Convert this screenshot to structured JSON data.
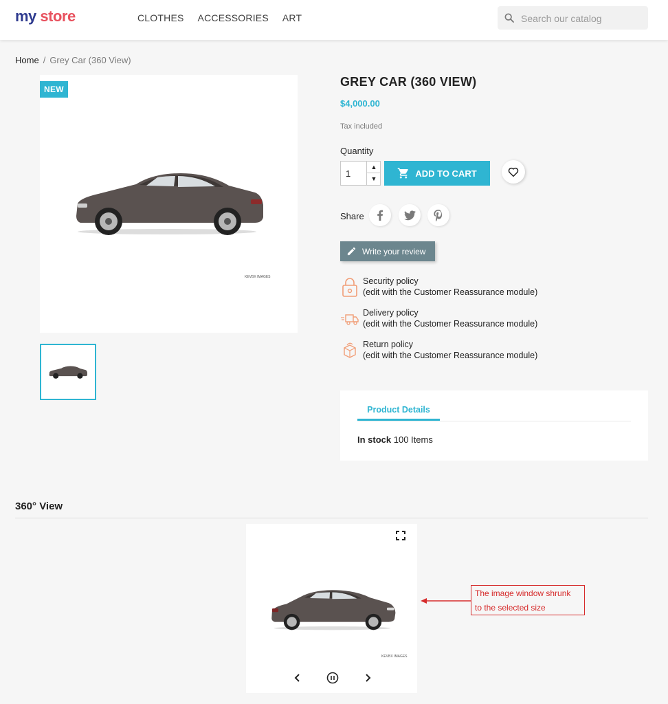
{
  "header": {
    "logo_part1": "my",
    "logo_part2": "store",
    "nav": [
      "CLOTHES",
      "ACCESSORIES",
      "ART"
    ],
    "search_placeholder": "Search our catalog"
  },
  "breadcrumb": {
    "home": "Home",
    "separator": "/",
    "current": "Grey Car (360 View)"
  },
  "product": {
    "badge": "NEW",
    "watermark": "KEVBX IMAGES",
    "title": "GREY CAR (360 VIEW)",
    "price": "$4,000.00",
    "tax_note": "Tax included",
    "quantity_label": "Quantity",
    "quantity_value": "1",
    "add_to_cart": "ADD TO CART",
    "share_label": "Share",
    "review_button": "Write your review"
  },
  "reassurance": [
    {
      "title": "Security policy",
      "desc": "(edit with the Customer Reassurance module)",
      "icon": "lock-icon"
    },
    {
      "title": "Delivery policy",
      "desc": "(edit with the Customer Reassurance module)",
      "icon": "truck-icon"
    },
    {
      "title": "Return policy",
      "desc": "(edit with the Customer Reassurance module)",
      "icon": "return-box-icon"
    }
  ],
  "details": {
    "tab_label": "Product Details",
    "stock_label": "In stock",
    "stock_value": "100 Items"
  },
  "view360": {
    "section_title": "360° View",
    "watermark": "KEVBX IMAGES"
  },
  "annotation": {
    "line1": "The image window shrunk",
    "line2": "to the selected size"
  },
  "colors": {
    "accent": "#2fb5d2",
    "review_button": "#6c868e",
    "annotation": "#d62b2b",
    "reassurance_icon": "#f19d76"
  }
}
